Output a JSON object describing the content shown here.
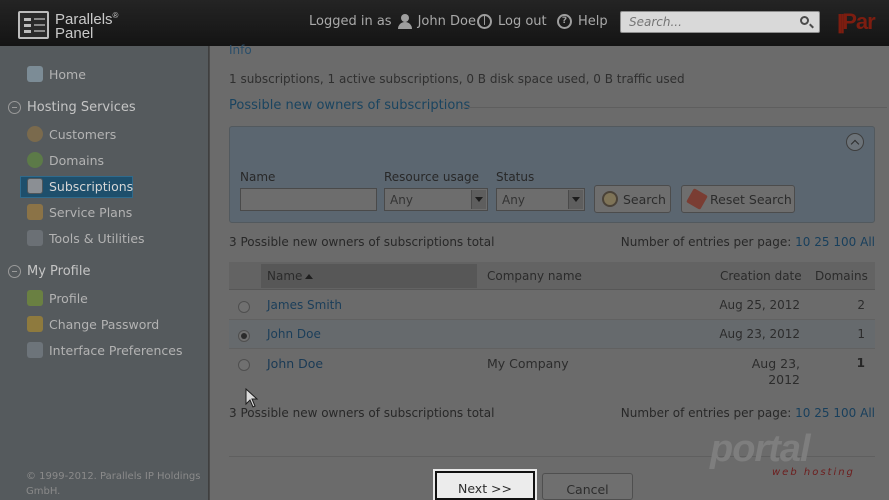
{
  "header": {
    "logo_line1": "Parallels",
    "logo_line2": "Panel",
    "logo_mark": "®",
    "logged_in_as_label": "Logged in as",
    "user_name": "John Doe",
    "logout_label": "Log out",
    "help_label": "Help",
    "search_placeholder": "Search...",
    "brand_partial": "Par"
  },
  "sidebar": {
    "home": "Home",
    "hosting_section": "Hosting Services",
    "hosting_items": [
      "Customers",
      "Domains",
      "Subscriptions",
      "Service Plans",
      "Tools & Utilities"
    ],
    "active_item": "Subscriptions",
    "profile_section": "My Profile",
    "profile_items": [
      "Profile",
      "Change Password",
      "Interface Preferences"
    ],
    "copyright_line1": "© 1999-2012. Parallels IP Holdings",
    "copyright_line2": "GmbH."
  },
  "main": {
    "info_heading": "Info",
    "summary": "1 subscriptions, 1 active subscriptions, 0 B disk space used, 0 B traffic used",
    "section_title": "Possible new owners of subscriptions",
    "filter": {
      "name_label": "Name",
      "name_value": "",
      "resource_label": "Resource usage",
      "resource_value": "Any",
      "status_label": "Status",
      "status_value": "Any",
      "search_button": "Search",
      "reset_button": "Reset Search"
    },
    "total_text": "3 Possible new owners of subscriptions total",
    "per_page_label": "Number of entries per page:",
    "per_page_options": [
      "10",
      "25",
      "100",
      "All"
    ],
    "table": {
      "columns": [
        "Name",
        "Company name",
        "Creation date",
        "Domains"
      ],
      "rows": [
        {
          "name": "James Smith",
          "company": "",
          "created": "Aug 25, 2012",
          "domains": "2",
          "selected": false
        },
        {
          "name": "John Doe",
          "company": "",
          "created": "Aug 23, 2012",
          "domains": "1",
          "selected": true
        },
        {
          "name": "John Doe",
          "company": "My Company",
          "created_line1": "Aug 23,",
          "created_line2": "2012",
          "domains": "1",
          "selected": false
        }
      ]
    },
    "next_button": "Next >>",
    "cancel_button": "Cancel"
  },
  "watermark": {
    "main": "portal",
    "sub": "web hosting"
  },
  "colors": {
    "accent_link": "#1b3e5a",
    "active_nav": "#1e4f6c",
    "brand": "#7d1d10"
  }
}
